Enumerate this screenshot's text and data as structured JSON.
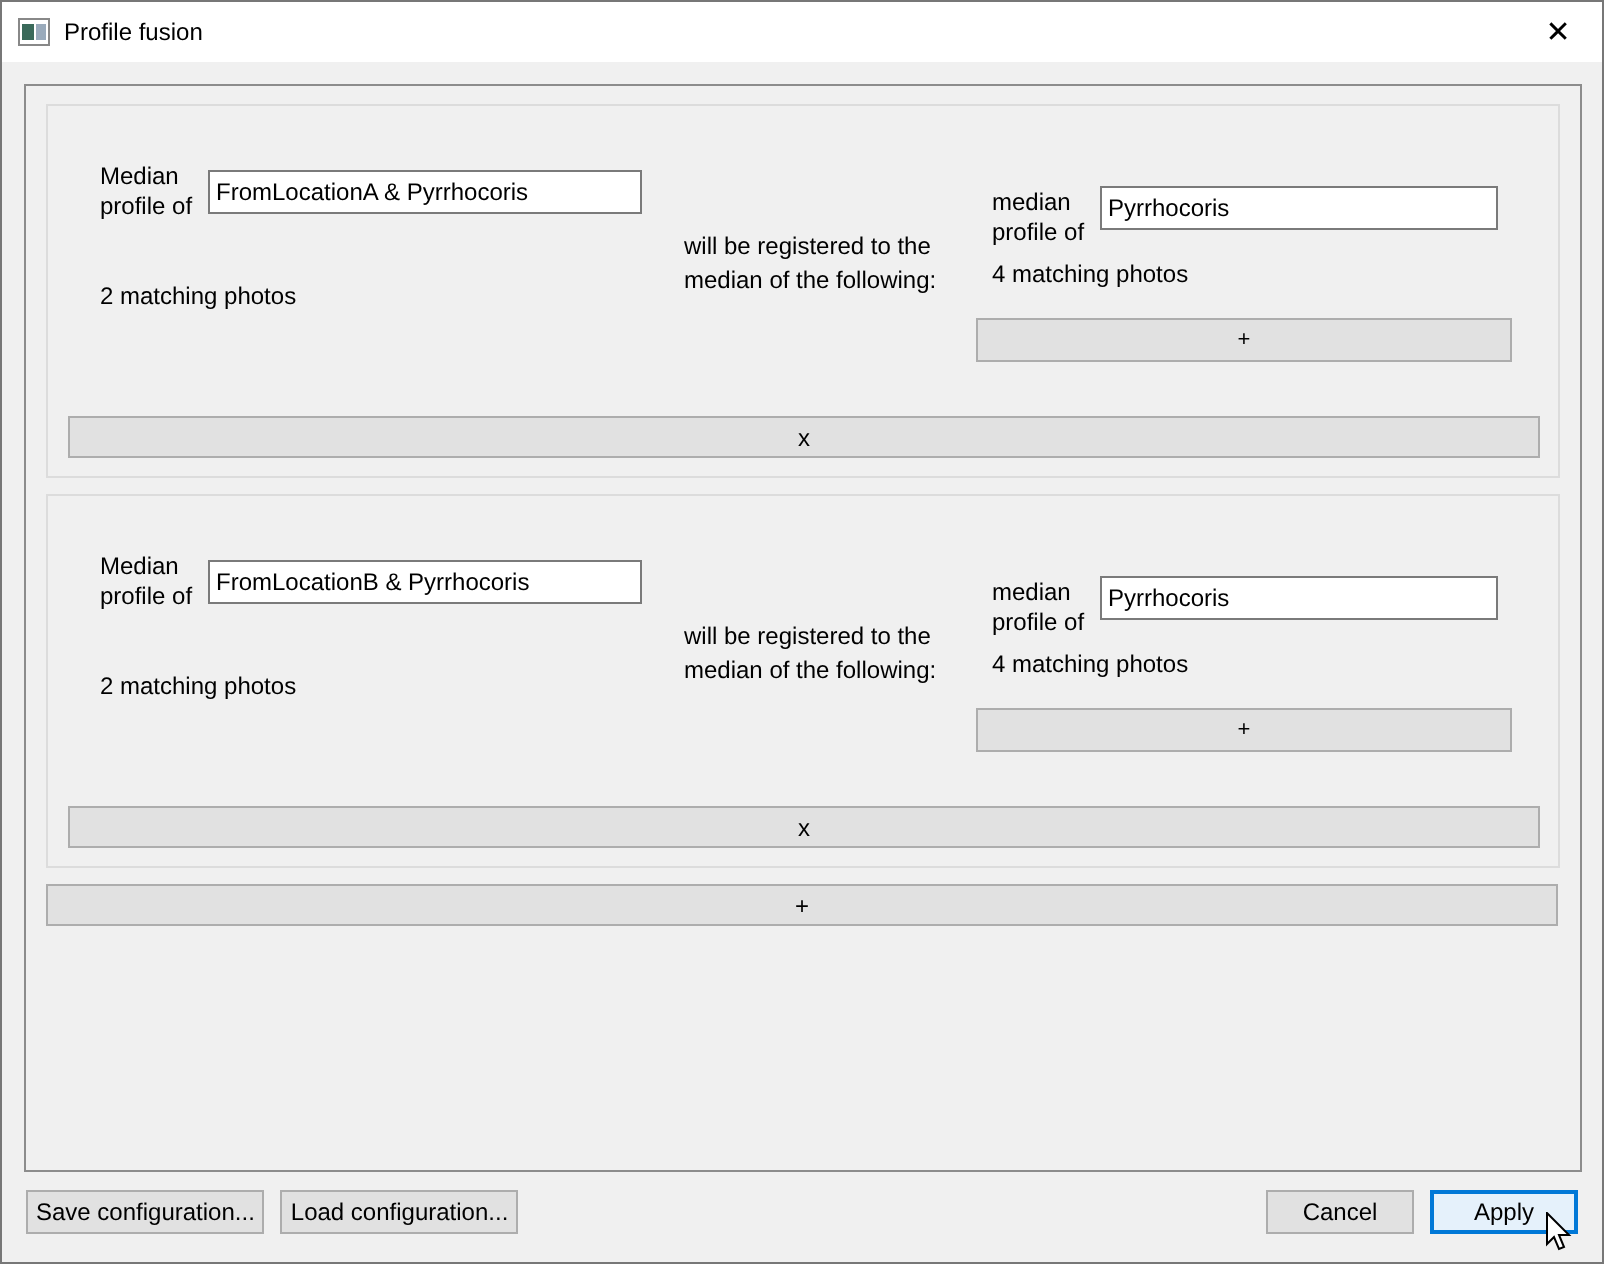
{
  "window": {
    "title": "Profile fusion",
    "close": "✕"
  },
  "groups": [
    {
      "source_label": "Median profile of",
      "source_value": "FromLocationA & Pyrrhocoris",
      "source_count": "2 matching photos",
      "link_text": "will be registered to the median of the following:",
      "targets": [
        {
          "label": "median profile of",
          "value": "Pyrrhocoris",
          "count": "4 matching photos"
        }
      ],
      "add_target_button": "+",
      "remove_button": "x"
    },
    {
      "source_label": "Median profile of",
      "source_value": "FromLocationB & Pyrrhocoris",
      "source_count": "2 matching photos",
      "link_text": "will be registered to the median of the following:",
      "targets": [
        {
          "label": "median profile of",
          "value": "Pyrrhocoris",
          "count": "4 matching photos"
        }
      ],
      "add_target_button": "+",
      "remove_button": "x"
    }
  ],
  "add_group_button": "+",
  "left_buttons": [
    {
      "label": "Save configuration...",
      "default": false
    },
    {
      "label": "Load configuration...",
      "default": false
    }
  ],
  "right_buttons": [
    {
      "label": "Cancel",
      "default": false
    },
    {
      "label": "Apply",
      "default": true
    }
  ]
}
